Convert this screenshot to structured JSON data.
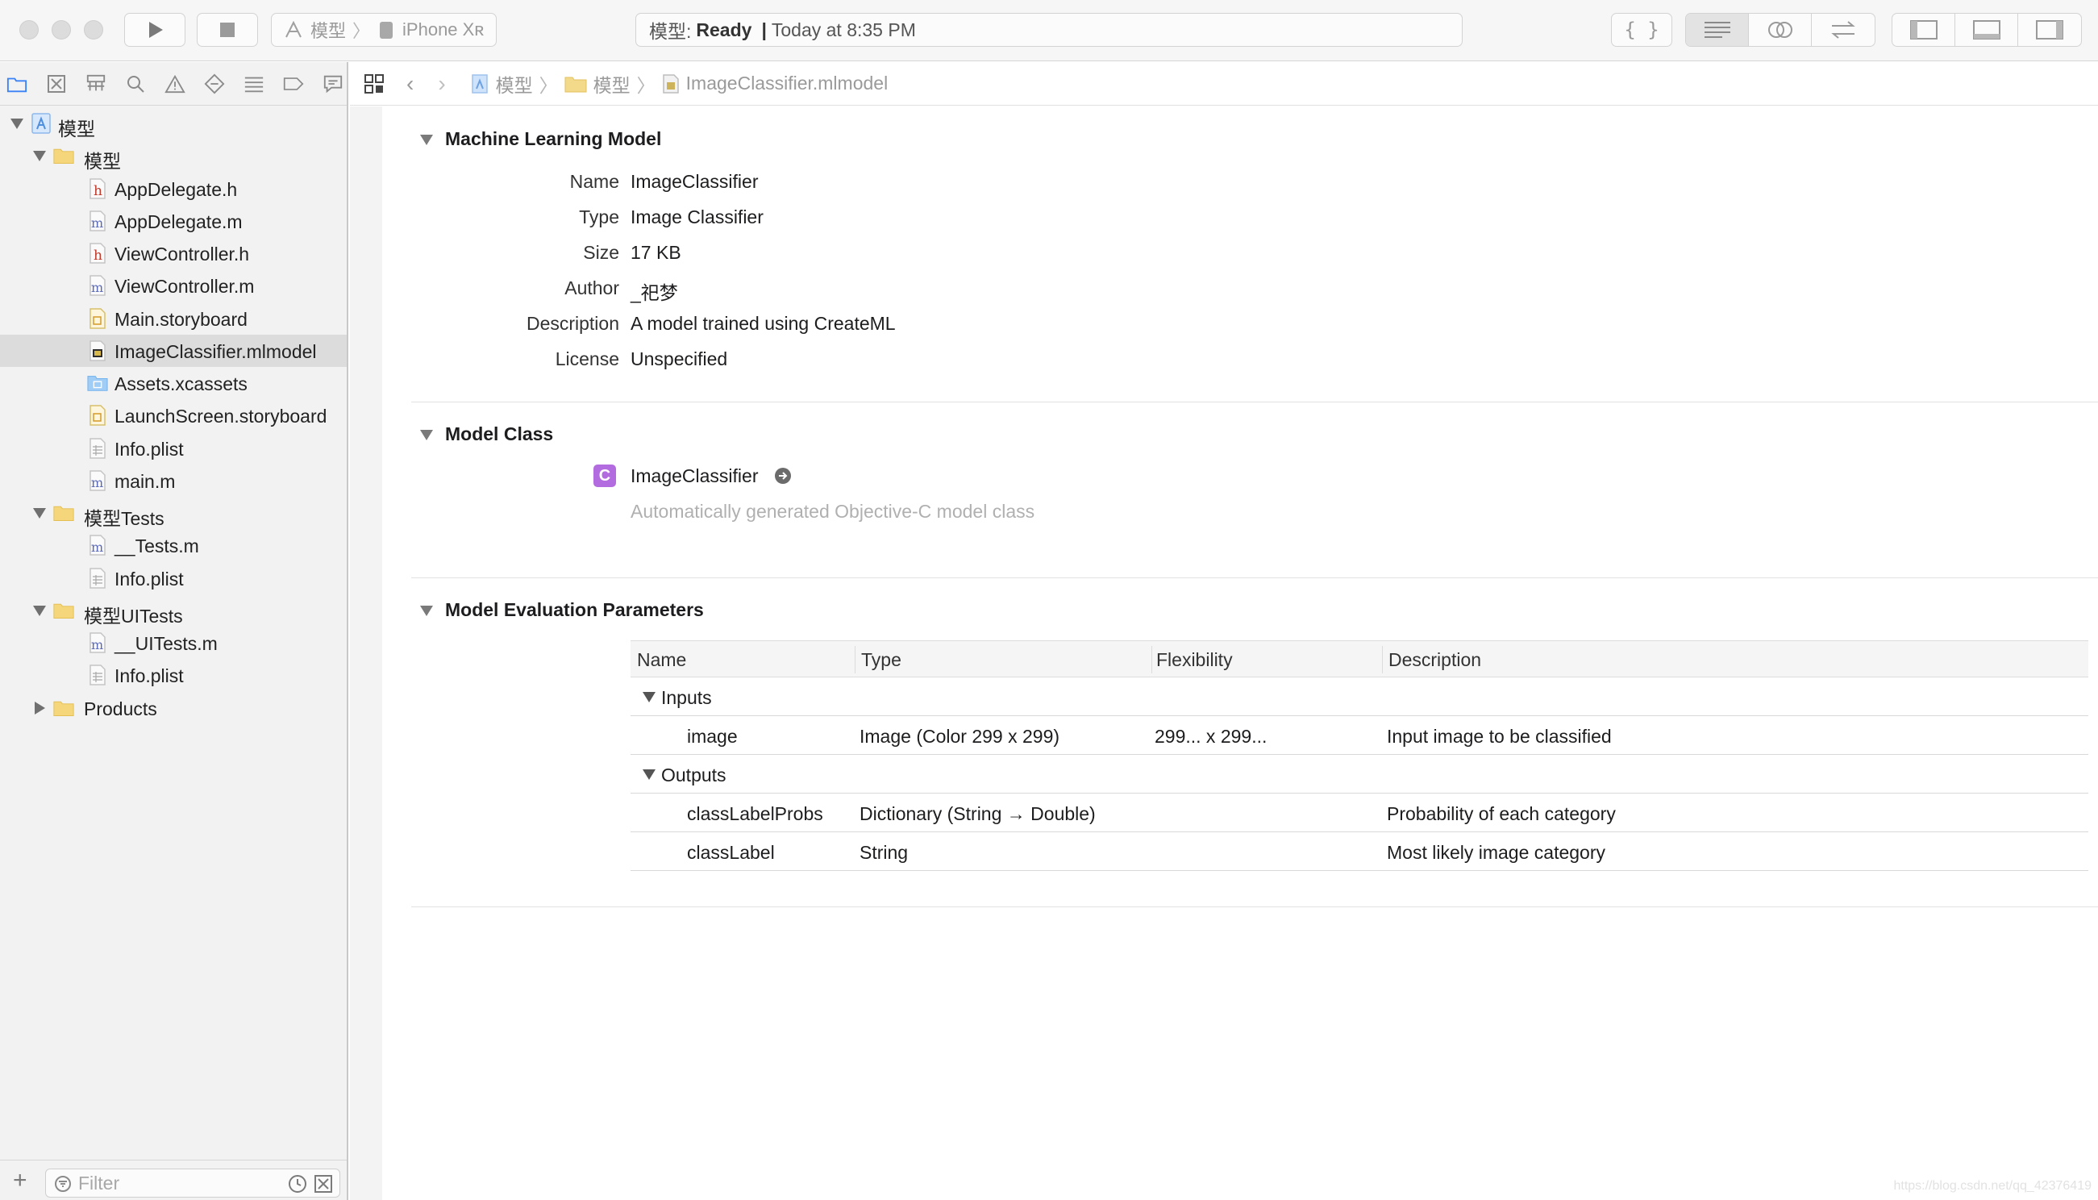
{
  "toolbar": {
    "scheme_project": "模型",
    "scheme_device": "iPhone Xʀ",
    "activity_project": "模型:",
    "activity_status": "Ready",
    "activity_separator": "|",
    "activity_time": "Today at 8:35 PM"
  },
  "navigator": {
    "items": [
      {
        "label": "模型",
        "kind": "project"
      },
      {
        "label": "模型",
        "kind": "folder"
      },
      {
        "label": "AppDelegate.h",
        "kind": "h"
      },
      {
        "label": "AppDelegate.m",
        "kind": "m"
      },
      {
        "label": "ViewController.h",
        "kind": "h"
      },
      {
        "label": "ViewController.m",
        "kind": "m"
      },
      {
        "label": "Main.storyboard",
        "kind": "storyboard"
      },
      {
        "label": "ImageClassifier.mlmodel",
        "kind": "mlmodel"
      },
      {
        "label": "Assets.xcassets",
        "kind": "assets"
      },
      {
        "label": "LaunchScreen.storyboard",
        "kind": "storyboard"
      },
      {
        "label": "Info.plist",
        "kind": "plist"
      },
      {
        "label": "main.m",
        "kind": "m"
      },
      {
        "label": "模型Tests",
        "kind": "folder"
      },
      {
        "label": "__Tests.m",
        "kind": "m"
      },
      {
        "label": "Info.plist",
        "kind": "plist"
      },
      {
        "label": "模型UITests",
        "kind": "folder"
      },
      {
        "label": "__UITests.m",
        "kind": "m"
      },
      {
        "label": "Info.plist",
        "kind": "plist"
      },
      {
        "label": "Products",
        "kind": "folder"
      }
    ],
    "selected_index": 7,
    "filter_placeholder": "Filter"
  },
  "jumpbar": {
    "crumbs": [
      "模型",
      "模型",
      "ImageClassifier.mlmodel"
    ]
  },
  "ml_model": {
    "section_title": "Machine Learning Model",
    "fields": [
      {
        "key": "Name",
        "value": "ImageClassifier"
      },
      {
        "key": "Type",
        "value": "Image Classifier"
      },
      {
        "key": "Size",
        "value": "17 KB"
      },
      {
        "key": "Author",
        "value": "_祀梦"
      },
      {
        "key": "Description",
        "value": "A model trained using CreateML"
      },
      {
        "key": "License",
        "value": "Unspecified"
      }
    ]
  },
  "model_class": {
    "section_title": "Model Class",
    "badge": "C",
    "class_name": "ImageClassifier",
    "note": "Automatically generated Objective-C model class"
  },
  "eval_params": {
    "section_title": "Model Evaluation Parameters",
    "columns": [
      "Name",
      "Type",
      "Flexibility",
      "Description"
    ],
    "inputs_label": "Inputs",
    "outputs_label": "Outputs",
    "inputs": [
      {
        "name": "image",
        "type": "Image (Color 299 x 299)",
        "flex": "299... x 299...",
        "desc": "Input image to be classified"
      }
    ],
    "outputs": [
      {
        "name": "classLabelProbs",
        "type": "Dictionary (String → Double)",
        "flex": "",
        "desc": "Probability of each category"
      },
      {
        "name": "classLabel",
        "type": "String",
        "flex": "",
        "desc": "Most likely image category"
      }
    ]
  },
  "watermark": "https://blog.csdn.net/qq_42376419"
}
